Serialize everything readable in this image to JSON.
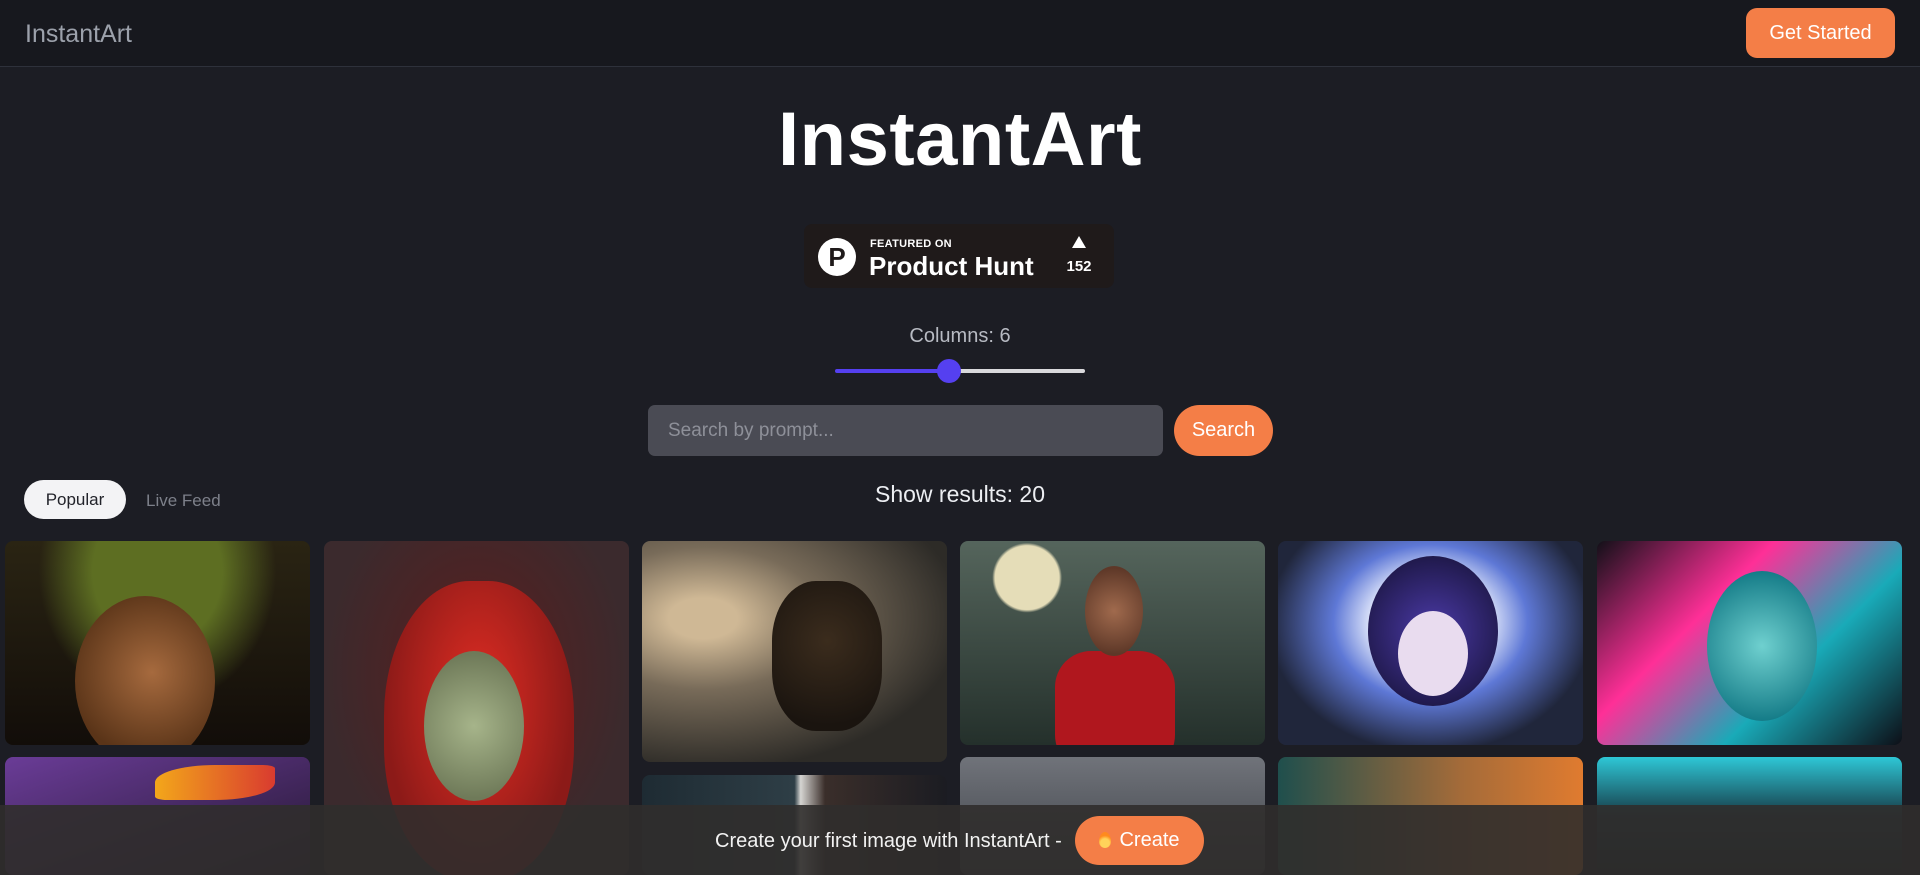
{
  "nav": {
    "brand": "InstantArt",
    "cta_label": "Get Started"
  },
  "hero": {
    "title": "InstantArt"
  },
  "product_hunt": {
    "logo_letter": "P",
    "featured": "FEATURED ON",
    "name": "Product Hunt",
    "votes": "152"
  },
  "columns": {
    "label_prefix": "Columns: ",
    "value": "6",
    "min": 1,
    "max": 12
  },
  "search": {
    "placeholder": "Search by prompt...",
    "button_label": "Search"
  },
  "tabs": [
    {
      "label": "Popular",
      "active": true
    },
    {
      "label": "Live Feed",
      "active": false
    }
  ],
  "results": {
    "label": "Show results: 20"
  },
  "gallery": [
    {
      "subject": "portrait-woman-green-hair"
    },
    {
      "subject": "portrait-red-haired-woman"
    },
    {
      "subject": "german-shepherd-in-fog"
    },
    {
      "subject": "man-red-hoodie"
    },
    {
      "subject": "anime-girl-purple"
    },
    {
      "subject": "neon-pink-woman"
    },
    {
      "subject": "feathered-warrior"
    },
    {
      "subject": "dark-haired-figures"
    },
    {
      "subject": "cloudy-street"
    },
    {
      "subject": "orange-sky-helmet"
    },
    {
      "subject": "cyan-neon-portrait"
    }
  ],
  "bottom_bar": {
    "text": "Create your first image with InstantArt -",
    "button_label": "Create"
  },
  "colors": {
    "accent": "#f47e47",
    "slider": "#5540f0",
    "background": "#1c1d24"
  }
}
